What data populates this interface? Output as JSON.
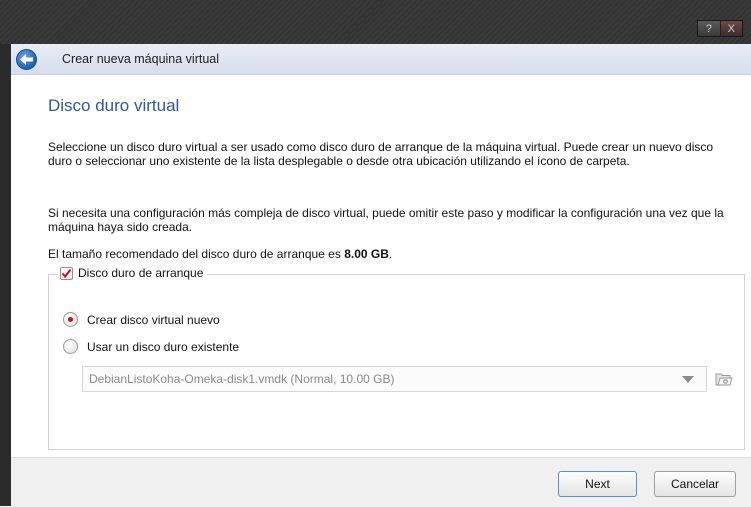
{
  "window": {
    "help_button": "?",
    "close_button": "X"
  },
  "header": {
    "title": "Crear nueva máquina virtual"
  },
  "page": {
    "title": "Disco duro virtual",
    "paragraph1": "Seleccione un disco duro virtual a ser usado como disco duro de arranque de la máquina virtual. Puede crear un nuevo disco duro o seleccionar uno existente de la lista desplegable o desde otra ubicación utilizando el ícono de carpeta.",
    "paragraph2": "Si necesita una configuración más compleja de disco virtual, puede omitir este paso y modificar la configuración una vez que la máquina haya sido creada.",
    "recommended_prefix": "El tamaño recomendado del disco duro de arranque es ",
    "recommended_size": "8.00 GB",
    "recommended_suffix": "."
  },
  "boot_disk": {
    "label": "Disco duro de arranque",
    "checked": true,
    "option_create": "Crear disco virtual nuevo",
    "option_existing": "Usar un disco duro existente",
    "selected_option": "create",
    "existing_disk_value": "DebianListoKoha-Omeka-disk1.vmdk (Normal, 10.00 GB)"
  },
  "footer": {
    "next_label": "Next",
    "cancel_label": "Cancelar"
  },
  "colors": {
    "accent": "#2c57a8",
    "radio_selected": "#c4141b"
  }
}
